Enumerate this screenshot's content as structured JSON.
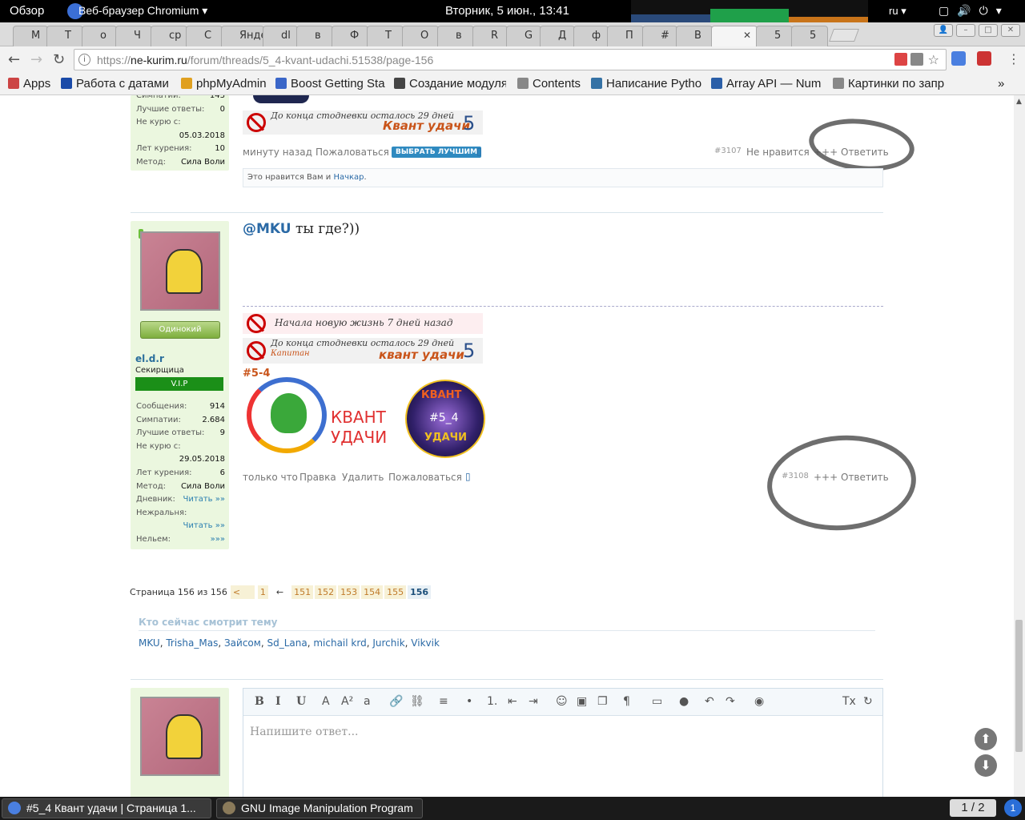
{
  "topbar": {
    "overview": "Обзор",
    "app_name": "Веб-браузер Chromium",
    "app_menu_arrow": "▾",
    "clock": "Вторник,  5 июн., 13:41",
    "language": "ru",
    "language_arrow": "▾"
  },
  "tabs": [
    {
      "label": "M",
      "color": "#222"
    },
    {
      "label": "T",
      "color": "#ddd"
    },
    {
      "label": "o",
      "color": "#e33"
    },
    {
      "label": "Ч",
      "color": "#f2c200"
    },
    {
      "label": "ср",
      "color": "#e33"
    },
    {
      "label": "С",
      "color": "#333"
    },
    {
      "label": "Янде",
      "color": "#ddd"
    },
    {
      "label": "dl",
      "color": "#e33"
    },
    {
      "label": "в",
      "color": "#e33"
    },
    {
      "label": "Ф",
      "color": "#c8a030"
    },
    {
      "label": "Т",
      "color": "#6a9"
    },
    {
      "label": "О",
      "color": "#2b7de0"
    },
    {
      "label": "в",
      "color": "#f0b000"
    },
    {
      "label": "R",
      "color": "#ddd"
    },
    {
      "label": "G",
      "color": "#444"
    },
    {
      "label": "Д",
      "color": "#b22"
    },
    {
      "label": "ф",
      "color": "#e33"
    },
    {
      "label": "П",
      "color": "#d22"
    },
    {
      "label": "#",
      "color": "#d22"
    },
    {
      "label": "В",
      "color": "#d22"
    },
    {
      "label": "",
      "color": "#d22"
    },
    {
      "label": "5",
      "color": "#d22"
    },
    {
      "label": "5",
      "color": "#1a9c4b"
    }
  ],
  "tab_close": "✕",
  "nav": {
    "back": "←",
    "forward": "→",
    "reload": "↻",
    "info": "i"
  },
  "url": {
    "scheme": "https://",
    "host": "ne-kurim.ru",
    "path": "/forum/threads/5_4-kvant-udachi.51538/page-156"
  },
  "star": "☆",
  "bookmarks": [
    {
      "label": "Apps",
      "color": "#c44"
    },
    {
      "label": "Работа с датами",
      "color": "#1a4aa8"
    },
    {
      "label": "phpMyAdmin",
      "color": "#e0a020"
    },
    {
      "label": "Boost Getting Sta",
      "color": "#3a66c8"
    },
    {
      "label": "Создание модуля",
      "color": "#444"
    },
    {
      "label": "Contents",
      "color": "#888"
    },
    {
      "label": "Написание Pytho",
      "color": "#3572a5"
    },
    {
      "label": "Array API — Num",
      "color": "#2b5fa8"
    },
    {
      "label": "Картинки по запр",
      "color": "#888"
    }
  ],
  "bookmarks_more": "»",
  "post1": {
    "stats": [
      {
        "label": "Симпатии:",
        "value": "143"
      },
      {
        "label": "Лучшие ответы:",
        "value": "0"
      },
      {
        "label": "Не курю с:",
        "value": ""
      },
      {
        "label": "",
        "value": "05.03.2018"
      },
      {
        "label": "Лет курения:",
        "value": "10"
      },
      {
        "label": "Метод:",
        "value": "Сила Воли"
      }
    ],
    "sig_days": "До конца стодневки осталось 29 дней",
    "sig_brand": "Квант удачи",
    "sig_num": "5",
    "time": "минуту назад",
    "report": "Пожаловаться",
    "best_btn": "ВЫБРАТЬ ЛУЧШИМ",
    "bookmark_icon": "bookmark-icon",
    "number": "#3107",
    "dislike": "Не нравится",
    "plus": "+++",
    "reply": "Ответить",
    "likes_prefix": "Это нравится Вам и",
    "likes_user": "Начкар",
    "likes_suffix": "."
  },
  "post2": {
    "mention": "@MKU",
    "text": " ты где?))",
    "user": {
      "badge": "Одинокий",
      "name": "el.d.r",
      "title": "Секирщица",
      "vip": "V.I.P"
    },
    "stats": [
      {
        "label": "Сообщения:",
        "value": "914"
      },
      {
        "label": "Симпатии:",
        "value": "2.684"
      },
      {
        "label": "Лучшие ответы:",
        "value": "9"
      },
      {
        "label": "Не курю с:",
        "value": ""
      },
      {
        "label": "",
        "value": "29.05.2018"
      },
      {
        "label": "Лет курения:",
        "value": "6"
      },
      {
        "label": "Метод:",
        "value": "Сила Воли"
      },
      {
        "label": "Дневник:",
        "value": "Читать »»"
      },
      {
        "label": "Нежральня:",
        "value": ""
      },
      {
        "label": "",
        "value": "Читать »»"
      },
      {
        "label": "Нельем:",
        "value": "»»»"
      }
    ],
    "sig_new_life": "Начала новую жизнь 7 дней назад",
    "sig_days": "До конца стодневки осталось 29 дней",
    "sig_rank": "Капитан",
    "sig_brand": "квант удачи",
    "sig_num": "5",
    "logo_tag": "#5-4",
    "logo_word1": "КВАНТ",
    "logo_word2": "УДАЧИ",
    "badge_top": "КВАНТ",
    "badge_mid": "#5_4",
    "badge_bottom": "УДАЧИ",
    "time": "только что",
    "edit": "Правка",
    "delete": "Удалить",
    "report": "Пожаловаться",
    "number": "#3108",
    "plus": "+++",
    "reply": "Ответить"
  },
  "pagination": {
    "label": "Страница 156 из 156",
    "prev": "<",
    "first": "1",
    "ellipsis": "←",
    "pages": [
      "151",
      "152",
      "153",
      "154",
      "155",
      "156"
    ]
  },
  "watchers": {
    "title": "Кто сейчас смотрит тему",
    "names": [
      "MKU",
      "Trisha_Mas",
      "Зайсом",
      "Sd_Lana",
      "michail krd",
      "Jurchik",
      "Vikvik"
    ]
  },
  "editor": {
    "placeholder": "Напишите ответ...",
    "tools": [
      "B",
      "I",
      "U",
      "A",
      "A²",
      "a",
      "🔗",
      "⛓",
      "≡",
      "•",
      "1.",
      "⇤",
      "⇥",
      "☺",
      "▣",
      "❐",
      "¶",
      "▭",
      "●",
      "↶",
      "↷",
      "◉",
      "Tx",
      "↻"
    ]
  },
  "scroll_buttons": {
    "up": "⬆",
    "down": "⬇"
  },
  "taskbar": {
    "tasks": [
      {
        "label": "#5_4 Квант удачи | Страница 1...",
        "active": true
      },
      {
        "label": "GNU Image Manipulation Program",
        "active": false
      }
    ],
    "workspace": "1 / 2",
    "notifications": "1"
  }
}
